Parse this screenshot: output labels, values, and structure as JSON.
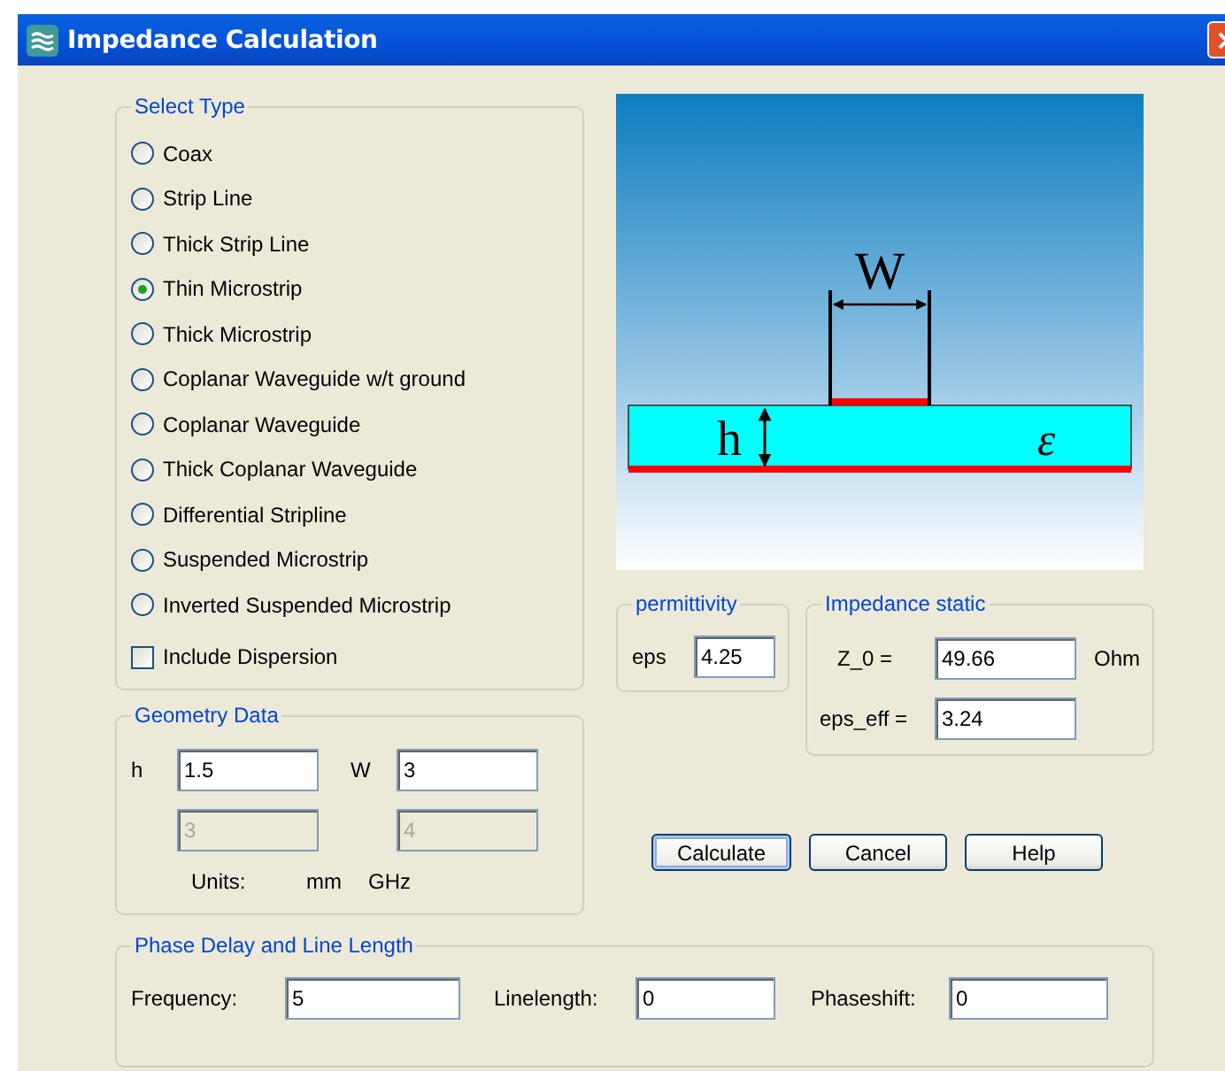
{
  "window": {
    "title": "Impedance Calculation"
  },
  "select_type": {
    "title": "Select Type",
    "options": [
      {
        "label": "Coax",
        "selected": false
      },
      {
        "label": "Strip Line",
        "selected": false
      },
      {
        "label": "Thick Strip Line",
        "selected": false
      },
      {
        "label": "Thin Microstrip",
        "selected": true
      },
      {
        "label": "Thick Microstrip",
        "selected": false
      },
      {
        "label": "Coplanar Waveguide w/t ground",
        "selected": false
      },
      {
        "label": "Coplanar Waveguide",
        "selected": false
      },
      {
        "label": "Thick Coplanar Waveguide",
        "selected": false
      },
      {
        "label": "Differential Stripline",
        "selected": false
      },
      {
        "label": "Suspended Microstrip",
        "selected": false
      },
      {
        "label": "Inverted Suspended Microstrip",
        "selected": false
      }
    ],
    "include_dispersion": {
      "label": "Include Dispersion",
      "checked": false
    }
  },
  "geometry": {
    "title": "Geometry Data",
    "fields": [
      {
        "label": "h",
        "value": "1.5",
        "disabled": false
      },
      {
        "label": "W",
        "value": "3",
        "disabled": false
      }
    ],
    "secondary_fields": [
      {
        "value": "3",
        "disabled": true
      },
      {
        "value": "4",
        "disabled": true
      }
    ],
    "units_label": "Units:",
    "units": [
      "mm",
      "GHz"
    ]
  },
  "diagram": {
    "width_label": "W",
    "height_label": "h",
    "permittivity_label": "ε"
  },
  "permittivity": {
    "title": "permittivity",
    "label": "eps",
    "value": "4.25"
  },
  "impedance": {
    "title": "Impedance static",
    "z0": {
      "label": "Z_0 =",
      "value": "49.66",
      "unit": "Ohm"
    },
    "eps_eff": {
      "label": "eps_eff =",
      "value": "3.24"
    }
  },
  "buttons": [
    {
      "label": "Calculate",
      "default": true
    },
    {
      "label": "Cancel",
      "default": false
    },
    {
      "label": "Help",
      "default": false
    }
  ],
  "phase": {
    "title": "Phase Delay and Line Length",
    "fields": [
      {
        "label": "Frequency:",
        "value": "5"
      },
      {
        "label": "Linelength:",
        "value": "0"
      },
      {
        "label": "Phaseshift:",
        "value": "0"
      }
    ]
  }
}
